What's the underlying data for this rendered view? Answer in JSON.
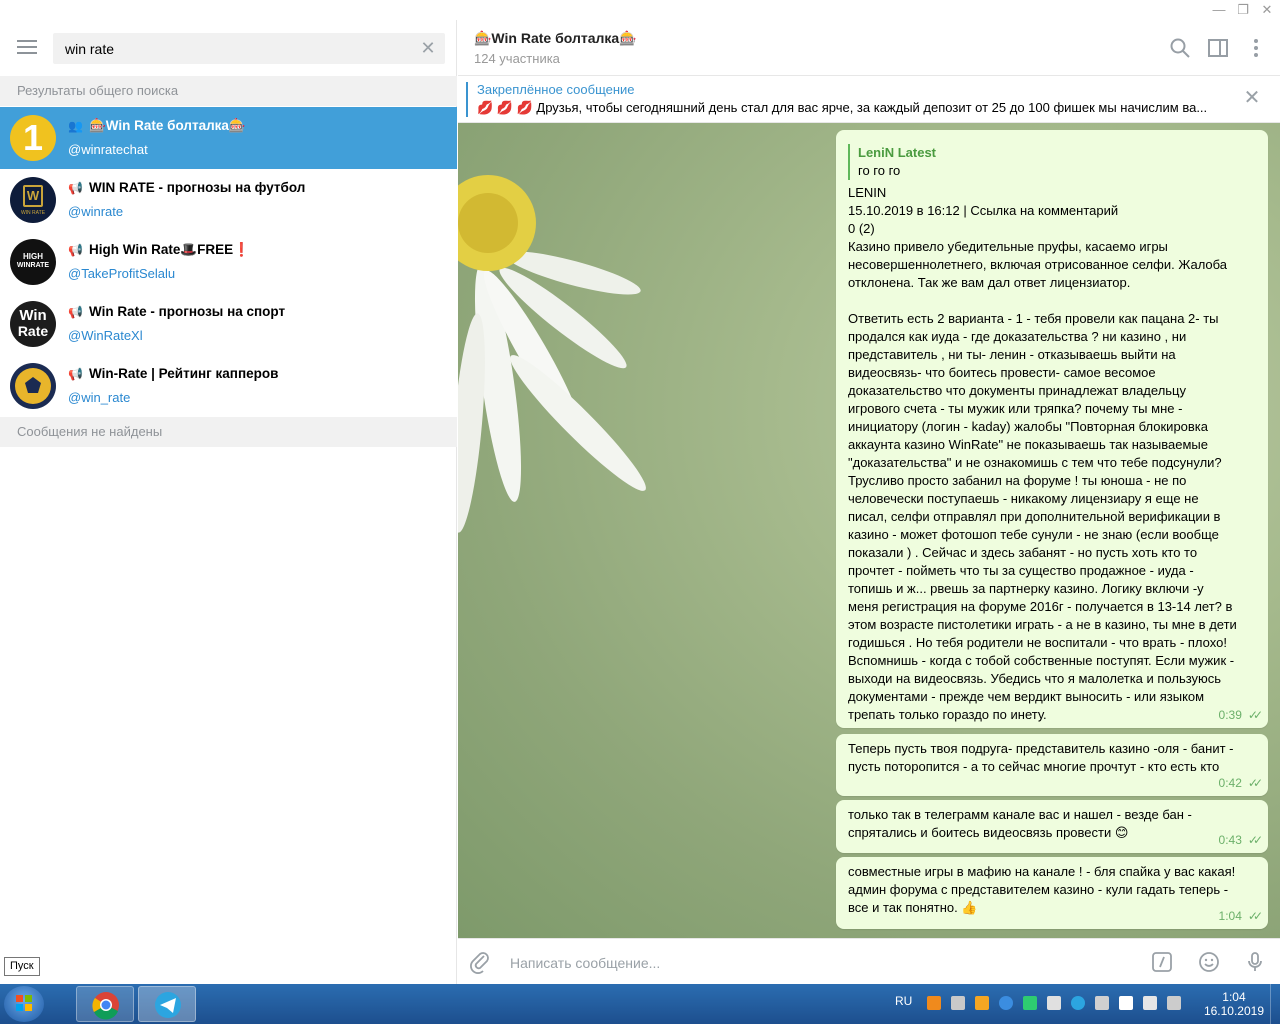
{
  "search": {
    "value": "win rate",
    "section_global": "Результаты общего поиска",
    "section_messages": "Сообщения не найдены"
  },
  "results": [
    {
      "title": "🎰Win Rate болталка🎰",
      "handle": "@winratechat",
      "kind": "group"
    },
    {
      "title": "WIN RATE - прогнозы на футбол",
      "handle": "@winrate",
      "kind": "channel"
    },
    {
      "title": "High Win Rate🎩FREE❗",
      "handle": "@TakeProfitSelalu",
      "kind": "channel"
    },
    {
      "title": "Win Rate - прогнозы на спорт",
      "handle": "@WinRateXl",
      "kind": "channel"
    },
    {
      "title": "Win-Rate | Рейтинг капперов",
      "handle": "@win_rate",
      "kind": "channel"
    }
  ],
  "avatars": {
    "a1": "1",
    "a2": "W",
    "a2_sub": "WIN RATE",
    "a3_line1": "HIGH",
    "a3_line2": "WINRATE",
    "a4_line1": "Win",
    "a4_line2": "Rate"
  },
  "chat": {
    "title": "🎰Win Rate болталка🎰",
    "members": "124 участника"
  },
  "pinned": {
    "title": "Закреплённое сообщение",
    "text": "💋 💋 💋 Друзья, чтобы сегодняшний день стал для вас ярче, за каждый депозит от 25 до 100 фишек мы начислим ва..."
  },
  "messages": {
    "m1": {
      "quote_name": "LeniN Latest",
      "quote_text": "го го го",
      "lines": [
        "LENIN",
        "15.10.2019 в 16:12 | Ссылка на комментарий",
        "0 (2)",
        "Казино привело убедительные пруфы, касаемо игры",
        "несовершеннолетнего, включая отрисованное селфи. Жалоба",
        "отклонена. Так же вам дал ответ лицензиатор."
      ],
      "lines2": [
        "Ответить есть 2 варианта - 1 - тебя провели как пацана 2- ты",
        "продался как иуда - где доказательства ? ни казино , ни",
        "представитель , ни ты- ленин  - отказываешь выйти на",
        "видеосвязь- что  боитесь  провести- самое весомое",
        "доказательство что документы принадлежат владельцу",
        "игрового счета  - ты мужик или тряпка? почему ты мне -",
        "инициатору (логин - kaday) жалобы \"Повторная блокировка",
        "аккаунта казино WinRate\"  не показываешь так называемые",
        "\"доказательства\"  и  не ознакомишь с тем что тебе подсунули?",
        "Трусливо просто забанил на форуме ! ты юноша - не по",
        "человечески поступаешь - никакому лицензиару я еще не",
        "писал, селфи отправлял при дополнительной верификации в",
        "казино - может фотошоп тебе сунули - не знаю (если вообще",
        "показали ) . Сейчас и здесь забанят - но пусть хоть кто то",
        "прочтет - пойметь что ты за существо продажное - иуда -",
        "топишь и ж... рвешь  за партнерку казино. Логику включи -у",
        "меня  регистрация на форуме 2016г - получается в 13-14 лет? в",
        "этом возрасте пистолетики играть - а не в казино, ты мне в дети",
        "годишься . Но тебя родители не воспитали - что врать - плохо!",
        "Вспомнишь - когда с тобой собственные поступят. Если мужик -",
        "выходи на видеосвязь. Убедись что я малолетка и пользуюсь",
        "документами - прежде чем вердикт выносить - или языком",
        "трепать только гораздо по инету."
      ],
      "time": "0:39"
    },
    "m2": {
      "lines": [
        "Теперь пусть твоя подруга- представитель казино -оля - банит -",
        "пусть поторопится - а то сейчас многие прочтут - кто есть кто"
      ],
      "time": "0:42"
    },
    "m3": {
      "lines": [
        "только так в телеграмм канале вас и нашел - везде бан -",
        "спрятались и боитесь видеосвязь провести 😊"
      ],
      "time": "0:43"
    },
    "m4": {
      "lines": [
        "совместные игры в мафию на канале ! - бля спайка у вас какая!",
        "админ форума с представителем казино - кули гадать теперь -",
        "все и так понятно. 👍"
      ],
      "time": "1:04"
    }
  },
  "composer": {
    "placeholder": "Написать сообщение..."
  },
  "tooltip": "Пуск",
  "taskbar": {
    "lang": "RU",
    "time": "1:04",
    "date": "16.10.2019"
  },
  "colors": {
    "accent": "#419fd9",
    "link": "#2a88d0",
    "bubble": "#effdde",
    "check": "#6cb06a"
  }
}
